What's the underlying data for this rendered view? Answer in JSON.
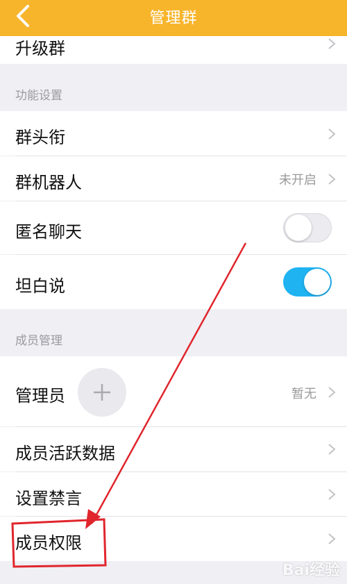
{
  "header": {
    "title": "管理群"
  },
  "rows": {
    "upgrade": {
      "label": "升级群"
    },
    "title_badge": {
      "label": "群头衔"
    },
    "robot": {
      "label": "群机器人",
      "value": "未开启"
    },
    "anonymous": {
      "label": "匿名聊天",
      "toggle": "off"
    },
    "honest": {
      "label": "坦白说",
      "toggle": "on"
    },
    "admin": {
      "label": "管理员",
      "value": "暂无"
    },
    "activity": {
      "label": "成员活跃数据"
    },
    "mute": {
      "label": "设置禁言"
    },
    "permission": {
      "label": "成员权限"
    }
  },
  "sections": {
    "features": "功能设置",
    "members": "成员管理"
  },
  "icons": {
    "back": "back-chevron-icon",
    "chevron": "chevron-right-icon",
    "add": "plus-icon"
  },
  "watermark": "Bai经验",
  "colors": {
    "header": "#f7b52c",
    "toggle_on": "#1fb3f2",
    "annotation": "#e0252c"
  }
}
